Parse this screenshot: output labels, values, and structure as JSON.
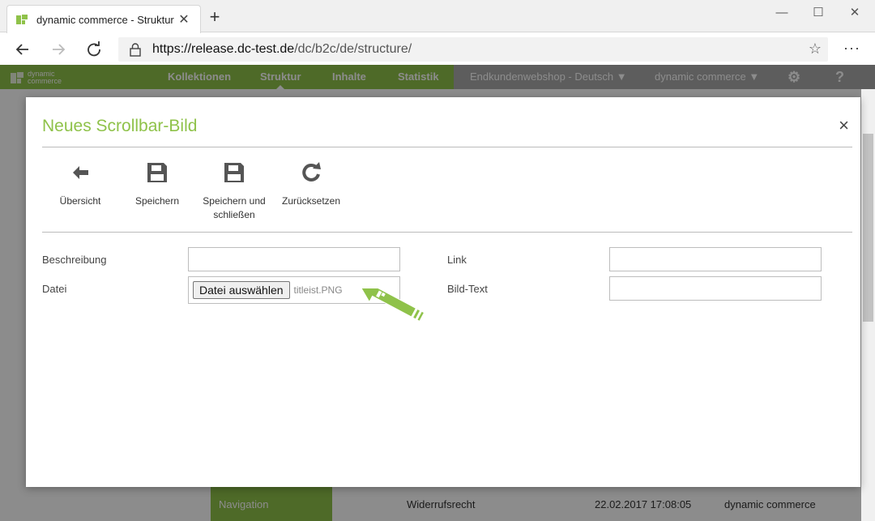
{
  "browser": {
    "tab_title": "dynamic commerce - Struktur",
    "tab_close": "✕",
    "new_tab": "+",
    "url_host": "https://release.dc-test.de",
    "url_path": "/dc/b2c/de/structure/",
    "minimize": "—",
    "maximize": "☐",
    "close": "✕",
    "more": "···"
  },
  "appnav": {
    "logo_line1": "dynamic",
    "logo_line2": "commerce",
    "items": [
      "Kollektionen",
      "Struktur",
      "Inhalte",
      "Statistik"
    ],
    "shop_select": "Endkundenwebshop - Deutsch",
    "company_select": "dynamic commerce",
    "help": "?"
  },
  "background": {
    "nav_label": "Navigation",
    "row": {
      "name": "Widerrufsrecht",
      "date": "22.02.2017 17:08:05",
      "author": "dynamic commerce"
    }
  },
  "modal": {
    "title": "Neues Scrollbar-Bild",
    "close": "×",
    "toolbar": {
      "overview": "Übersicht",
      "save": "Speichern",
      "save_close_1": "Speichern und",
      "save_close_2": "schließen",
      "reset": "Zurücksetzen"
    },
    "form": {
      "description_label": "Beschreibung",
      "description_value": "",
      "file_label": "Datei",
      "file_button": "Datei auswählen",
      "file_name": "titleist.PNG",
      "link_label": "Link",
      "link_value": "",
      "image_text_label": "Bild-Text",
      "image_text_value": ""
    }
  },
  "colors": {
    "brand_green": "#8fc24a",
    "nav_grey": "#a9a9a9"
  }
}
